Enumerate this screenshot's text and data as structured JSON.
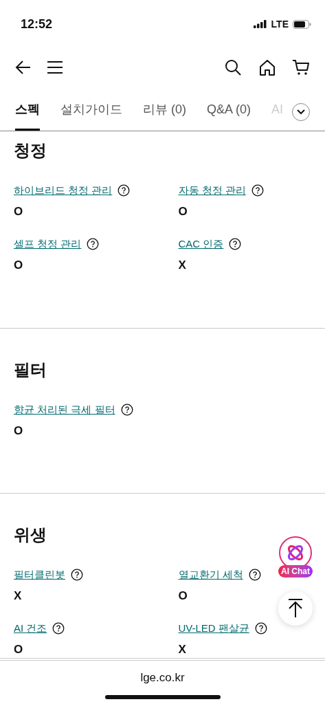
{
  "status_bar": {
    "time": "12:52",
    "network": "LTE"
  },
  "tabs": [
    {
      "label": "스펙",
      "selected": true
    },
    {
      "label": "설치가이드",
      "selected": false
    },
    {
      "label": "리뷰 (0)",
      "selected": false
    },
    {
      "label": "Q&A (0)",
      "selected": false
    },
    {
      "label": "AI",
      "selected": false
    }
  ],
  "sections": [
    {
      "title": "청정",
      "items": [
        {
          "label": "하이브리드 청정 관리",
          "value": "O"
        },
        {
          "label": "자동 청정 관리",
          "value": "O"
        },
        {
          "label": "셀프 청정 관리",
          "value": "O"
        },
        {
          "label": "CAC 인증",
          "value": "X"
        }
      ]
    },
    {
      "title": "필터",
      "items": [
        {
          "label": "향균 처리된 극세 필터",
          "value": "O"
        }
      ]
    },
    {
      "title": "위생",
      "items": [
        {
          "label": "필터클린봇",
          "value": "X"
        },
        {
          "label": "열교환기 세척",
          "value": "O"
        },
        {
          "label": "AI 건조",
          "value": "O"
        },
        {
          "label": "UV-LED 팬살균",
          "value": "X"
        }
      ]
    }
  ],
  "ai_chat": {
    "label": "AI Chat"
  },
  "address_bar": {
    "url": "lge.co.kr"
  }
}
